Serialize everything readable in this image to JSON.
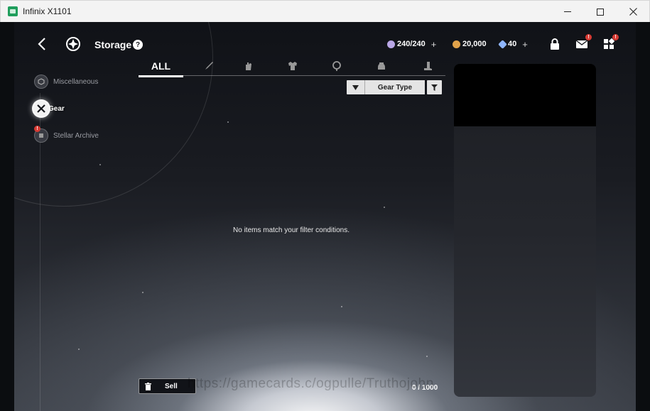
{
  "window": {
    "title": "Infinix X1101",
    "controls": {
      "minimize": "minimize-icon",
      "maximize": "maximize-icon",
      "close": "close-icon"
    }
  },
  "header": {
    "title": "Storage",
    "help": "?",
    "currencies": [
      {
        "name": "stamina",
        "value": "240/240",
        "add": "+",
        "color": "#b9a7e6"
      },
      {
        "name": "credits",
        "value": "20,000",
        "color": "#e0a24a"
      },
      {
        "name": "gems",
        "value": "40",
        "add": "+",
        "color": "#8fb6ff"
      }
    ],
    "icons": [
      "lock-icon",
      "mail-icon",
      "menu-grid-icon"
    ],
    "badges": {
      "mail": "!",
      "menu": "!"
    }
  },
  "sidebar": {
    "items": [
      {
        "label": "Miscellaneous",
        "icon": "box-icon",
        "active": false
      },
      {
        "label": "Gear",
        "icon": "crossed-swords-icon",
        "active": true
      },
      {
        "label": "Stellar Archive",
        "icon": "cube-icon",
        "active": false,
        "badge": "!"
      }
    ]
  },
  "tabs": {
    "all_label": "ALL",
    "icons": [
      "sword-tab-icon",
      "glove-tab-icon",
      "armor-tab-icon",
      "ring-tab-icon",
      "helmet-tab-icon",
      "boots-tab-icon"
    ],
    "active": "ALL"
  },
  "filter": {
    "sort_label": "Gear Type"
  },
  "main": {
    "empty_message": "No items match your filter conditions."
  },
  "footer": {
    "sell_label": "Sell",
    "capacity": "0 / 1000",
    "watermark": "https://gamecards.c/ogpulle/Truthojohn"
  },
  "colors": {
    "accent": "#ffffff",
    "badge": "#d63a33"
  }
}
